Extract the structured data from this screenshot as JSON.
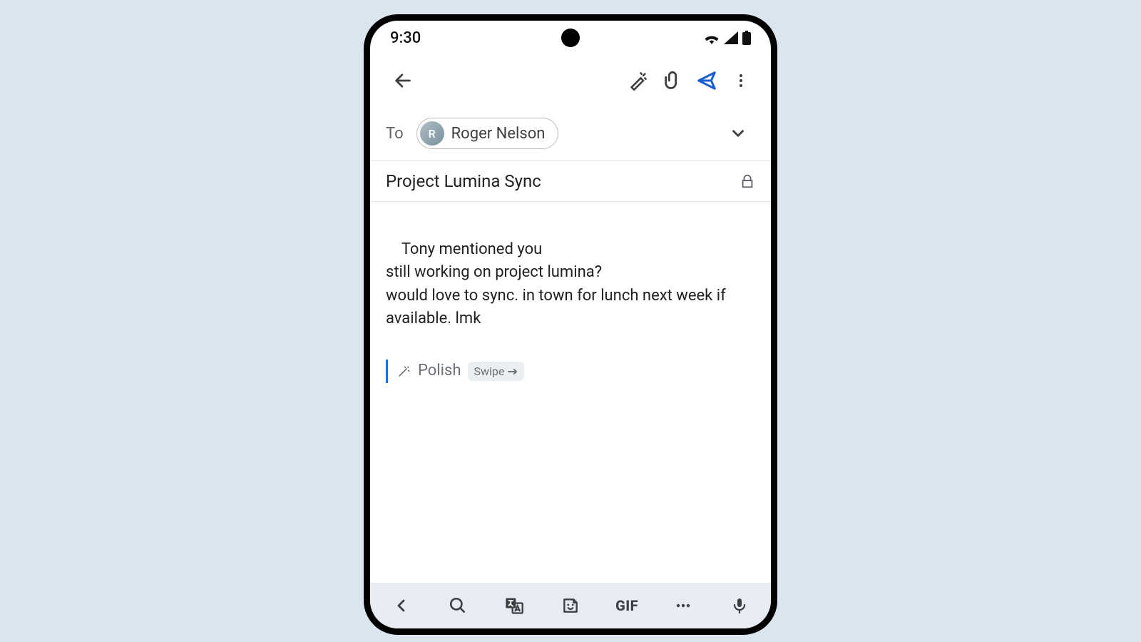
{
  "status": {
    "time": "9:30"
  },
  "compose": {
    "to_label": "To",
    "recipient": "Roger Nelson",
    "recipient_initial": "R",
    "subject": "Project Lumina Sync",
    "body": "Tony mentioned you\nstill working on project lumina?\nwould love to sync. in town for lunch next week if available. lmk",
    "polish_label": "Polish",
    "swipe_label": "Swipe"
  },
  "kbd": {
    "gif": "GIF"
  }
}
